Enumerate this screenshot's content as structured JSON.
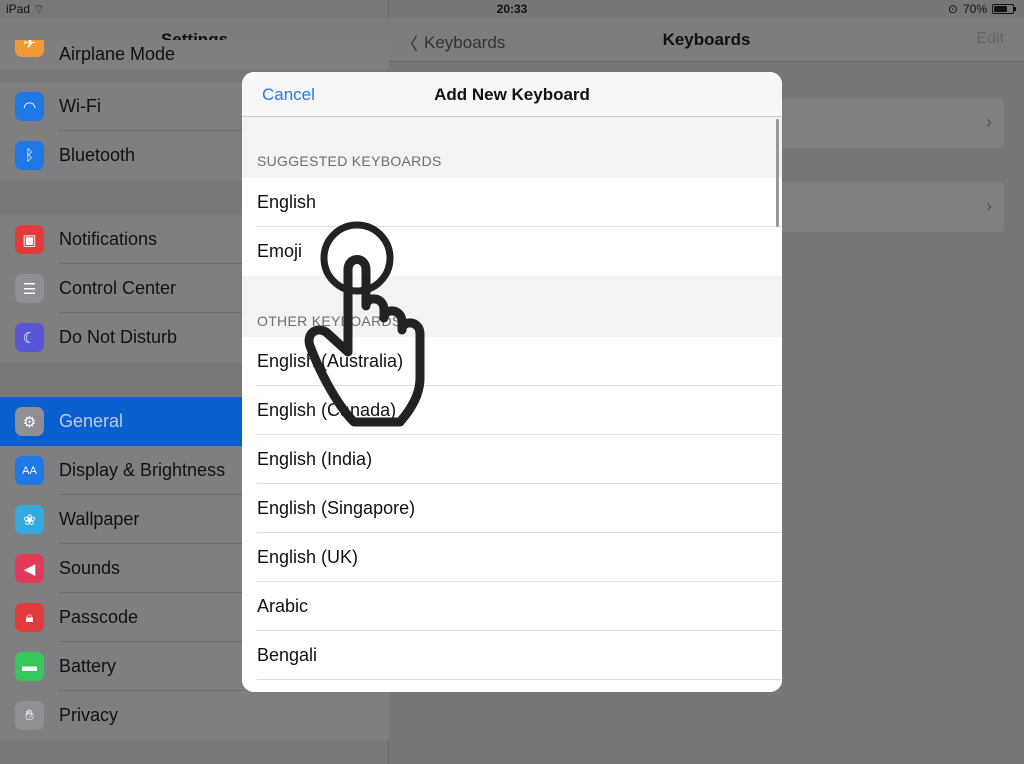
{
  "status": {
    "device": "iPad",
    "time": "20:33",
    "battery": "70%"
  },
  "sidebar": {
    "title": "Settings",
    "partial_item": "Airplane Mode",
    "items": [
      {
        "label": "Wi-Fi",
        "icon": "wifi-icon",
        "color": "#1e78e6"
      },
      {
        "label": "Bluetooth",
        "icon": "bluetooth-icon",
        "color": "#1e78e6"
      },
      {
        "label": "Notifications",
        "icon": "notifications-icon",
        "color": "#e23b3b"
      },
      {
        "label": "Control Center",
        "icon": "control-center-icon",
        "color": "#8e8e93"
      },
      {
        "label": "Do Not Disturb",
        "icon": "moon-icon",
        "color": "#5856d6"
      },
      {
        "label": "General",
        "icon": "gear-icon",
        "color": "#8e8e93"
      },
      {
        "label": "Display & Brightness",
        "icon": "display-icon",
        "color": "#1e78e6"
      },
      {
        "label": "Wallpaper",
        "icon": "wallpaper-icon",
        "color": "#33aadd"
      },
      {
        "label": "Sounds",
        "icon": "sounds-icon",
        "color": "#e23b5a"
      },
      {
        "label": "Passcode",
        "icon": "lock-icon",
        "color": "#e23b3b"
      },
      {
        "label": "Battery",
        "icon": "battery-icon",
        "color": "#34c759"
      },
      {
        "label": "Privacy",
        "icon": "hand-icon",
        "color": "#8e8e93"
      }
    ]
  },
  "detail": {
    "back": "Keyboards",
    "title": "Keyboards",
    "edit": "Edit"
  },
  "modal": {
    "cancel": "Cancel",
    "title": "Add New Keyboard",
    "suggested_label": "SUGGESTED KEYBOARDS",
    "suggested": [
      "English",
      "Emoji"
    ],
    "other_label": "OTHER KEYBOARDS",
    "other": [
      "English (Australia)",
      "English (Canada)",
      "English (India)",
      "English (Singapore)",
      "English (UK)",
      "Arabic",
      "Bengali"
    ]
  }
}
